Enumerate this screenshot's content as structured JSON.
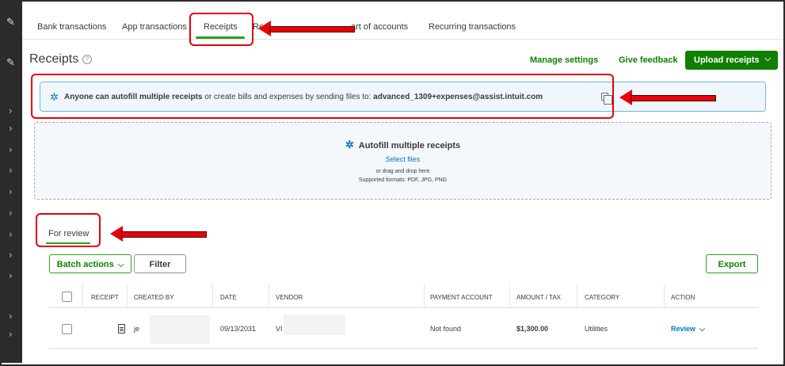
{
  "tabs": [
    {
      "label": "Bank transactions"
    },
    {
      "label": "App transactions"
    },
    {
      "label": "Receipts"
    },
    {
      "label": "Re"
    },
    {
      "label": "art of accounts"
    },
    {
      "label": "Recurring transactions"
    }
  ],
  "header": {
    "title": "Receipts",
    "help_icon": "?",
    "manage_settings": "Manage settings",
    "give_feedback": "Give feedback",
    "upload_receipts": "Upload receipts"
  },
  "banner": {
    "bold_text": "Anyone can autofill multiple receipts",
    "mid_text": " or create bills and expenses by sending files to: ",
    "email": "advanced_1309+expenses@assist.intuit.com",
    "icons": [
      "sparkle-icon",
      "copy-icon"
    ]
  },
  "dropzone": {
    "title": "Autofill multiple receipts",
    "select_files": "Select files",
    "or_drag": "or drag and drop here",
    "formats": "Supported formats: PDF, JPG, PNG"
  },
  "review_tab": {
    "label": "For review"
  },
  "actions": {
    "batch_actions": "Batch actions",
    "filter": "Filter",
    "export": "Export"
  },
  "table": {
    "columns": [
      "Receipt",
      "Created by",
      "Date",
      "Vendor",
      "Payment account",
      "Amount / tax",
      "Category",
      "Action"
    ],
    "rows": [
      {
        "created_by": "je",
        "date": "09/13/2031",
        "vendor": "VI",
        "payment_account": "Not found",
        "amount": "$1,300.00",
        "category": "Utilities",
        "action": "Review"
      }
    ]
  },
  "colors": {
    "brand_green": "#108000",
    "link_blue": "#0077c5",
    "annotation_red": "#e8000b",
    "rail": "#2b2b2b"
  }
}
